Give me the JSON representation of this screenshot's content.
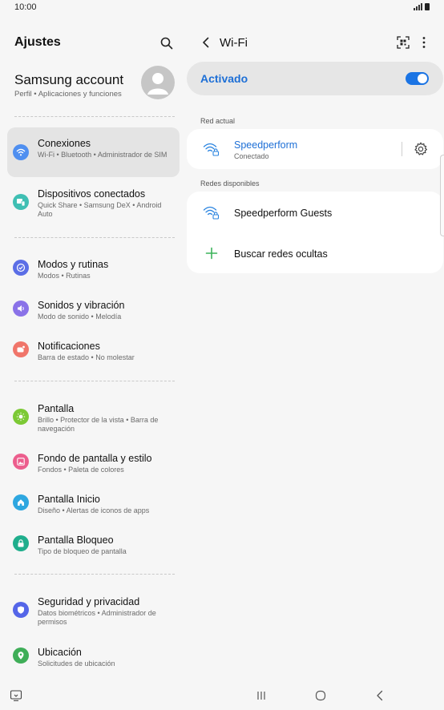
{
  "status_bar": {
    "time": "10:00"
  },
  "left": {
    "title": "Ajustes",
    "account": {
      "name": "Samsung account",
      "subtitle": "Perfil  •  Aplicaciones y funciones"
    },
    "items": [
      {
        "title": "Conexiones",
        "subtitle": "Wi-Fi  •  Bluetooth  •  Administrador de SIM",
        "icon": "wifi-icon",
        "color": "#4f8ff0",
        "selected": true
      },
      {
        "title": "Dispositivos conectados",
        "subtitle": "Quick Share  •  Samsung DeX  •  Android Auto",
        "icon": "devices-icon",
        "color": "#3fbfb3"
      },
      {
        "title": "Modos y rutinas",
        "subtitle": "Modos  •  Rutinas",
        "icon": "check-icon",
        "color": "#5b6ee6"
      },
      {
        "title": "Sonidos y vibración",
        "subtitle": "Modo de sonido  •  Melodía",
        "icon": "speaker-icon",
        "color": "#8a72e8"
      },
      {
        "title": "Notificaciones",
        "subtitle": "Barra de estado  •  No molestar",
        "icon": "bell-icon",
        "color": "#f0756a"
      },
      {
        "title": "Pantalla",
        "subtitle": "Brillo  •  Protector de la vista  •  Barra de navegación",
        "icon": "sun-icon",
        "color": "#7cc935"
      },
      {
        "title": "Fondo de pantalla y estilo",
        "subtitle": "Fondos  •  Paleta de colores",
        "icon": "image-icon",
        "color": "#ec5e8d"
      },
      {
        "title": "Pantalla Inicio",
        "subtitle": "Diseño  •  Alertas de iconos de apps",
        "icon": "home-icon",
        "color": "#2ea7e0"
      },
      {
        "title": "Pantalla Bloqueo",
        "subtitle": "Tipo de bloqueo de pantalla",
        "icon": "lock-icon",
        "color": "#1fae8c"
      },
      {
        "title": "Seguridad y privacidad",
        "subtitle": "Datos biométricos  •  Administrador de permisos",
        "icon": "shield-icon",
        "color": "#5566e8"
      },
      {
        "title": "Ubicación",
        "subtitle": "Solicitudes de ubicación",
        "icon": "location-icon",
        "color": "#3fae58"
      }
    ]
  },
  "wifi": {
    "title": "Wi-Fi",
    "toggle_label": "Activado",
    "toggle_on": true,
    "current_label": "Red actual",
    "current_network": {
      "name": "Speedperform",
      "status": "Conectado"
    },
    "available_label": "Redes disponibles",
    "available": [
      {
        "name": "Speedperform Guests"
      }
    ],
    "hidden_label": "Buscar redes ocultas"
  },
  "colors": {
    "accent": "#1b74e4",
    "background": "#f6f6f6",
    "card": "#ffffff"
  }
}
